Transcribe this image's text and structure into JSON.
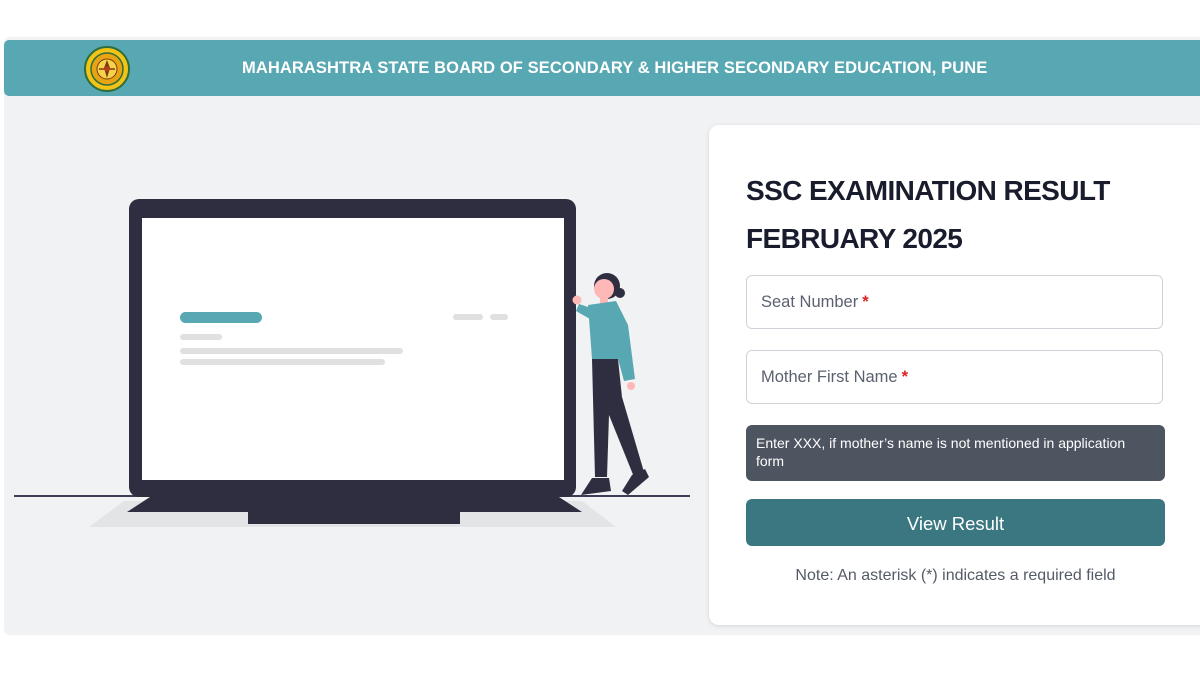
{
  "header": {
    "title": "MAHARASHTRA STATE BOARD OF SECONDARY & HIGHER SECONDARY EDUCATION, PUNE",
    "logo_icon": "board-emblem-icon"
  },
  "colors": {
    "header_bg": "#58a8b3",
    "button_bg": "#3a7781",
    "hint_bg": "#4d5561",
    "required": "#e02020",
    "page_bg": "#f1f2f4"
  },
  "form": {
    "title_line1": "SSC EXAMINATION RESULT",
    "title_line2": "FEBRUARY 2025",
    "seat_number": {
      "placeholder": "Seat Number",
      "required_mark": "*"
    },
    "mother_name": {
      "placeholder": "Mother First Name",
      "required_mark": "*"
    },
    "hint": "Enter XXX, if mother’s name is not mentioned in application form",
    "submit_label": "View Result",
    "note": "Note: An asterisk (*) indicates a required field"
  },
  "illustration": {
    "icon": "laptop-with-person-illustration"
  }
}
